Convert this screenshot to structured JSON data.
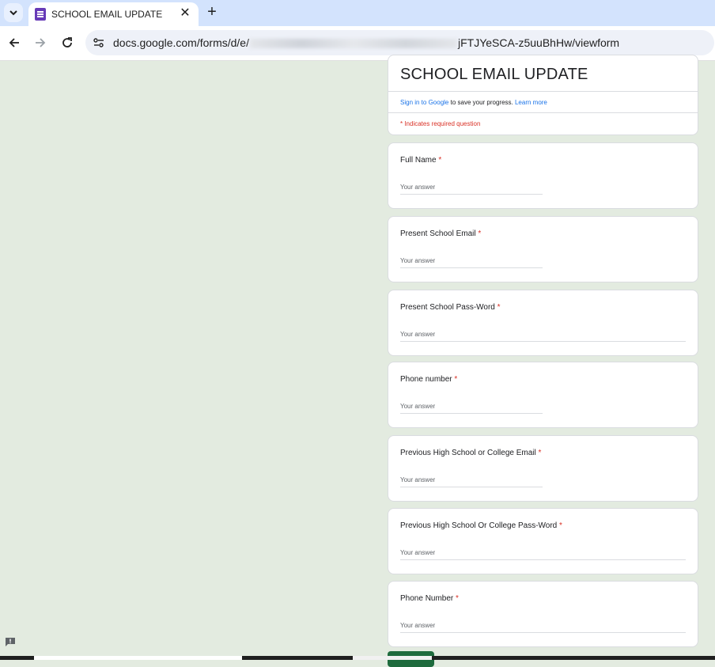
{
  "browser": {
    "tab": {
      "title": "SCHOOL EMAIL UPDATE",
      "favicon": "google-forms-icon"
    },
    "url": {
      "prefix": "docs.google.com/forms/d/e/",
      "suffix": "jFTJYeSCA-z5uuBhHw/viewform"
    },
    "colors": {
      "tabstrip": "#d3e3fd",
      "omnibox": "#eef1f8"
    }
  },
  "form": {
    "title": "SCHOOL EMAIL UPDATE",
    "signin_link": "Sign in to Google",
    "signin_text": " to save your progress. ",
    "learn_more": "Learn more",
    "required_note": "* Indicates required question",
    "placeholder": "Your answer",
    "questions": [
      {
        "label": "Full Name",
        "required": "*"
      },
      {
        "label": "Present School Email",
        "required": "*"
      },
      {
        "label": "Present School Pass-Word",
        "required": "*"
      },
      {
        "label": "Phone number",
        "required": "*"
      },
      {
        "label": "Previous High School or College Email",
        "required": "*"
      },
      {
        "label": "Previous High School Or College Pass-Word",
        "required": "*"
      },
      {
        "label": "Phone Number",
        "required": "*"
      }
    ],
    "colors": {
      "page_bg": "#e3ebe0",
      "required": "#d93025",
      "link": "#1a73e8",
      "submit": "#1e6b3d"
    }
  }
}
